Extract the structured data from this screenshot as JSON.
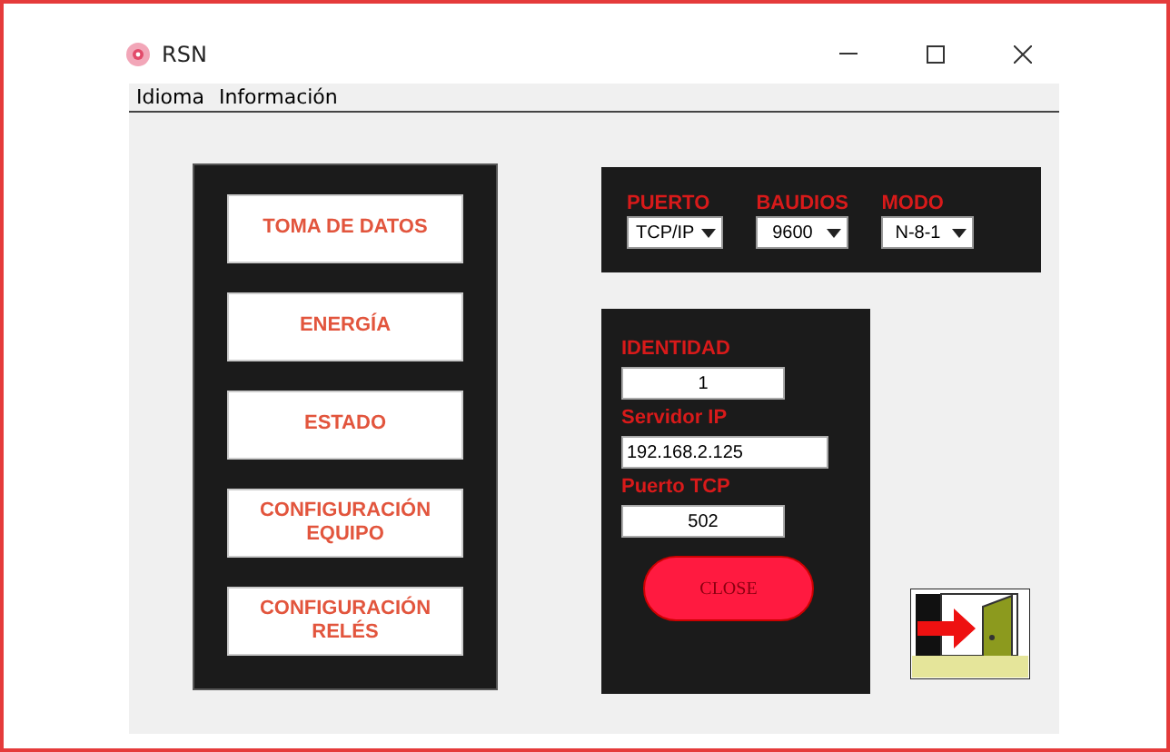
{
  "window": {
    "title": "RSN"
  },
  "menu": [
    "Idioma",
    "Información"
  ],
  "nav_buttons": [
    "TOMA DE DATOS",
    "ENERGÍA",
    "ESTADO",
    "CONFIGURACIÓN EQUIPO",
    "CONFIGURACIÓN RELÉS"
  ],
  "serial": [
    {
      "label": "PUERTO",
      "value": "TCP/IP"
    },
    {
      "label": "BAUDIOS",
      "value": "9600"
    },
    {
      "label": "MODO",
      "value": "N-8-1"
    }
  ],
  "network": [
    {
      "label": "IDENTIDAD",
      "value": "1"
    },
    {
      "label": "Servidor IP",
      "value": "192.168.2.125"
    },
    {
      "label": "Puerto TCP",
      "value": "502"
    }
  ],
  "close_button": "CLOSE"
}
